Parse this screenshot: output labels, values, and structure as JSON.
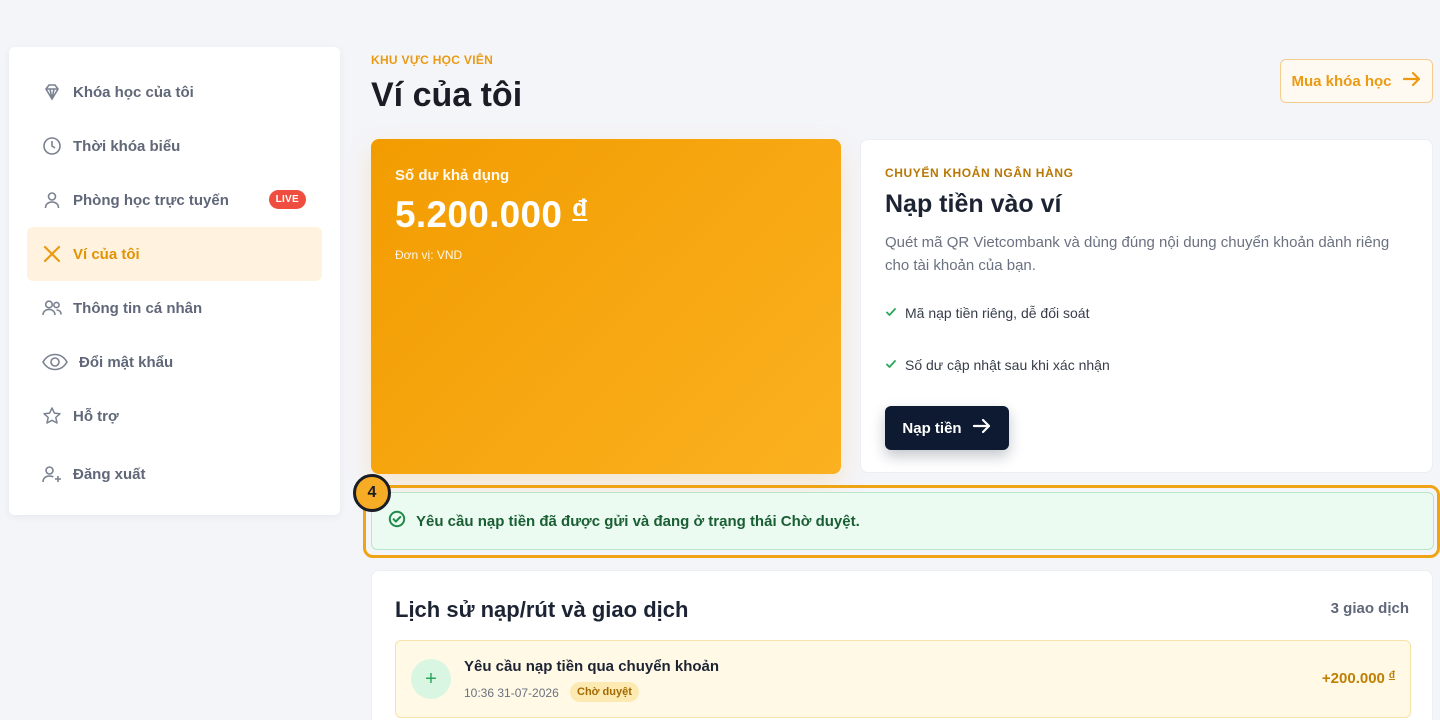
{
  "sidebar": {
    "items": [
      {
        "label": "Khóa học của tôi",
        "icon": "diamond-icon"
      },
      {
        "label": "Thời khóa biểu",
        "icon": "clock-icon"
      },
      {
        "label": "Phòng học trực tuyến",
        "icon": "user-icon",
        "badge": "LIVE"
      },
      {
        "label": "Ví của tôi",
        "icon": "close-x-icon",
        "active": true
      },
      {
        "label": "Thông tin cá nhân",
        "icon": "users-icon"
      },
      {
        "label": "Đổi mật khẩu",
        "icon": "eye-icon"
      },
      {
        "label": "Hỗ trợ",
        "icon": "star-icon"
      },
      {
        "label": "Đăng xuất",
        "icon": "user-plus-icon"
      }
    ]
  },
  "header": {
    "eyebrow": "KHU VỰC HỌC VIÊN",
    "title": "Ví của tôi",
    "buy_button": "Mua khóa học"
  },
  "balance": {
    "label": "Số dư khả dụng",
    "amount": "5.200.000",
    "currency": "đ",
    "unit": "Đơn vị: VND"
  },
  "deposit": {
    "eyebrow": "CHUYỂN KHOẢN NGÂN HÀNG",
    "title": "Nạp tiền vào ví",
    "description": "Quét mã QR Vietcombank và dùng đúng nội dung chuyển khoản dành riêng cho tài khoản của bạn.",
    "features": [
      "Mã nạp tiền riêng, dễ đối soát",
      "Số dư cập nhật sau khi xác nhận"
    ],
    "button": "Nạp tiền"
  },
  "alert": {
    "step": "4",
    "message": "Yêu cầu nạp tiền đã được gửi và đang ở trạng thái Chờ duyệt."
  },
  "history": {
    "title": "Lịch sử nạp/rút và giao dịch",
    "count": "3 giao dịch",
    "transactions": [
      {
        "title": "Yêu cầu nạp tiền qua chuyển khoản",
        "time": "10:36 31-07-2026",
        "status": "Chờ duyệt",
        "amount": "+200.000",
        "currency": "đ",
        "icon": "plus-icon"
      }
    ]
  },
  "colors": {
    "accent": "#eb9a11",
    "navy": "#0e1a31",
    "success_bg": "#ebfbf1",
    "live_red": "#ef4d3f"
  }
}
